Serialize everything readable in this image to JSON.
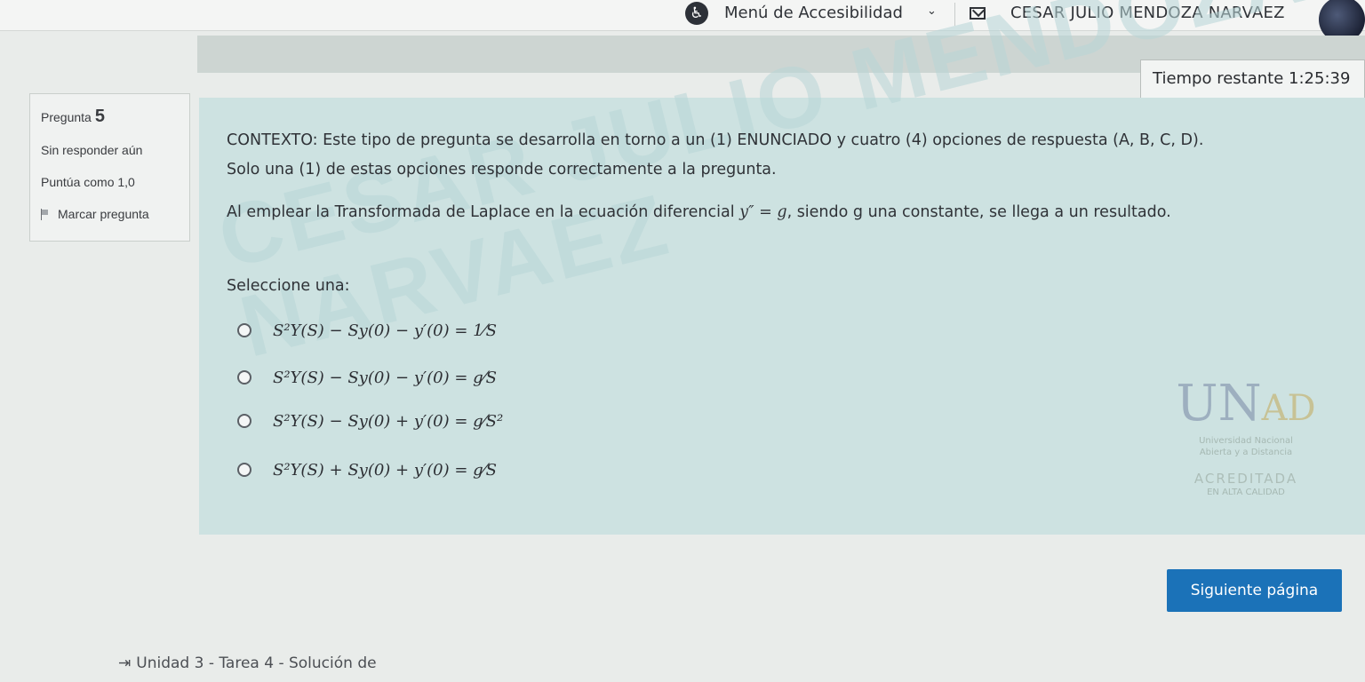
{
  "header": {
    "accessibility_icon": "accessibility-icon",
    "accessibility_menu": "Menú de Accesibilidad",
    "caret": "⌄",
    "message_icon": "message-icon",
    "user_name": "CESAR JULIO MENDOZA NARVAEZ"
  },
  "timer": {
    "label": "Tiempo restante",
    "value": "1:25:39"
  },
  "question_info": {
    "label": "Pregunta",
    "number": "5",
    "status": "Sin responder aún",
    "grade": "Puntúa como 1,0",
    "flag_label": "Marcar pregunta",
    "flag_icon": "flag-icon"
  },
  "question": {
    "context_line1": "CONTEXTO: Este tipo de pregunta se desarrolla en torno a un (1) ENUNCIADO y cuatro (4) opciones de respuesta (A, B, C, D).",
    "context_line2": "Solo una (1) de estas opciones responde correctamente a la pregunta.",
    "statement_before": "Al emplear la Transformada de Laplace en la ecuación diferencial",
    "statement_math": "y″ = g",
    "statement_after": ", siendo g una constante, se llega a un resultado.",
    "select_label": "Seleccione una:",
    "options": [
      {
        "text": "S²Y(S) − Sy(0) − y′(0) = 1⁄S"
      },
      {
        "text": "S²Y(S) − Sy(0) − y′(0) = g⁄S"
      },
      {
        "text": "S²Y(S) − Sy(0) + y′(0) = g⁄S²"
      },
      {
        "text": "S²Y(S) + Sy(0) + y′(0) = g⁄S"
      }
    ]
  },
  "watermark": {
    "line1": "CESAR JULIO MENDOZA",
    "line2": "NARVAEZ"
  },
  "logo": {
    "mark_main": "UN",
    "mark_accent": "AD",
    "line1": "Universidad Nacional",
    "line2": "Abierta y a Distancia",
    "accredited": "ACREDITADA",
    "quality": "EN ALTA CALIDAD"
  },
  "navigation": {
    "next_label": "Siguiente página",
    "previous_icon": "arrow-left-icon",
    "previous_link": "Unidad 3 - Tarea 4 - Solución de"
  },
  "colors": {
    "accent": "#1b72b8",
    "content_bg": "#cde2e1",
    "banner": "#cdd5d2"
  }
}
